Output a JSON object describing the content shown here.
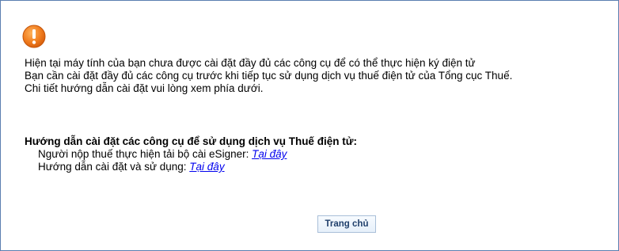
{
  "alert": {
    "icon": "exclamation-circle-icon",
    "icon_color": "#f07c1e",
    "lines": [
      "Hiện tại máy tính của bạn chưa được cài đặt đầy đủ các công cụ để có thể thực hiện ký điện tử",
      "Bạn cần cài đặt đầy đủ các công cụ trước khi tiếp tục sử dụng dịch vụ thuế điện tử của Tổng cục Thuế.",
      "Chi tiết hướng dẫn cài đặt vui lòng xem phía dưới."
    ]
  },
  "guide": {
    "title": "Hướng dẫn cài đặt các công cụ để sử dụng dịch vụ Thuế điện tử:",
    "items": [
      {
        "text": "Người nộp thuế thực hiện tải bộ cài eSigner: ",
        "link_label": "Tại đây"
      },
      {
        "text": "Hướng dẫn cài đặt và sử dụng: ",
        "link_label": "Tại đây"
      }
    ]
  },
  "actions": {
    "home_label": "Trang chủ"
  },
  "colors": {
    "frame_border": "#5b7fb0",
    "link": "#0000ee",
    "button_text": "#1f3f6b"
  }
}
